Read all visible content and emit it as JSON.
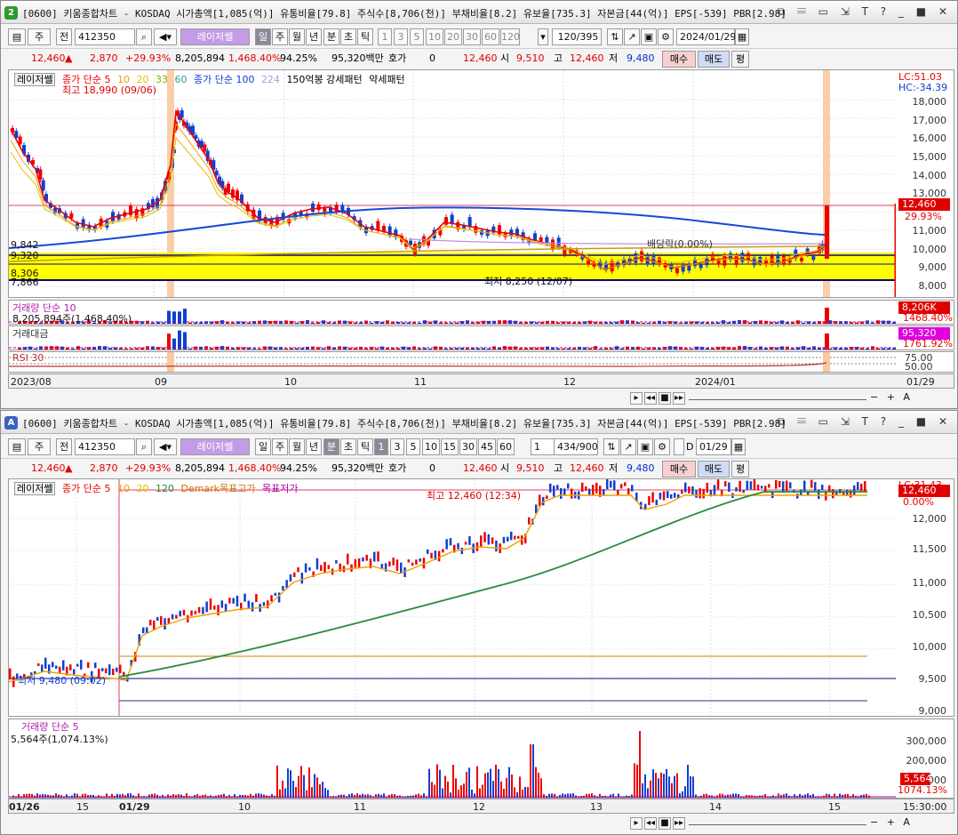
{
  "window1": {
    "badge": "2",
    "title": "[0600] 키움종합차트 - KOSDAQ 시가총액[1,085(억)] 유통비율[79.8] 주식수[8,706(천)] 부채비율[8.2] 유보율[735.3] 자본금[44(억)] EPS[-539] PBR[2.98]",
    "title_controls": "⧉ 𝄘 ▭ ⇲ T ? _ ■ ✕",
    "toolbar": {
      "code_prefix": "주",
      "all_label": "전",
      "stock_code": "412350",
      "search_icon": "🔍",
      "sound_icon": "◀)",
      "stock_name": "레이저쎌",
      "periods": [
        "일",
        "주",
        "월",
        "년",
        "분",
        "초",
        "틱"
      ],
      "minutes": [
        "1",
        "3",
        "5",
        "10",
        "20",
        "30",
        "60",
        "120"
      ],
      "count": "120/395",
      "date": "2024/01/29"
    },
    "quote": {
      "price": "12,460",
      "arrow": "▲",
      "change": "2,870",
      "pct": "+29.93%",
      "volume": "8,205,894",
      "vol_ratio": "1,468.40%",
      "ratio2": "94.25%",
      "amount": "95,320백만",
      "hoga_label": "호가",
      "hoga": "0",
      "hoga_price": "12,460",
      "open_label": "시",
      "open": "9,510",
      "high_label": "고",
      "high": "12,460",
      "low_label": "저",
      "low": "9,480",
      "buy": "매수",
      "sell": "매도",
      "flat": "평"
    },
    "legend": {
      "name": "레이저쎌",
      "ma_label": "종가 단순 5",
      "ma10": "10",
      "ma20": "20",
      "ma33": "33",
      "ma60": "60",
      "ma100": "종가 단순 100",
      "ma224": "224",
      "pattern": "150억봉 강세패턴",
      "weak": "약세패턴"
    },
    "annotations": {
      "high": "최고 18,990 (09/06)",
      "low": "최저 8,250 (12/07)",
      "dividend": "배당락(0.00%)",
      "lc": "LC:51.03",
      "hc": "HC:-34.39",
      "lvl1": "9,842",
      "lvl2": "9,320",
      "lvl3": "8,306",
      "lvl4": "7,866"
    },
    "y_labels": [
      "18,000",
      "17,000",
      "16,000",
      "15,000",
      "14,000",
      "13,000",
      "11,000",
      "10,000",
      "9,000",
      "8,000"
    ],
    "price_box": "12,460",
    "price_pct": "29.93%",
    "volume": {
      "label": "거래량 단순 10",
      "value": "8,205,894주(1,468.40%)",
      "box": "8,206K",
      "pct": "1468.40%"
    },
    "amount": {
      "label": "거래대금",
      "box": "95,320",
      "pct": "1761.92%"
    },
    "rsi": {
      "label": "RSI 30",
      "lvl75": "75.00",
      "lvl50": "50.00"
    },
    "x_labels": [
      "2023/08",
      "09",
      "10",
      "11",
      "12",
      "2024/01",
      "01/29"
    ]
  },
  "window2": {
    "badge": "A",
    "title": "[0600] 키움종합차트 - KOSDAQ 시가총액[1,085(억)] 유통비율[79.8] 주식수[8,706(천)] 부채비율[8.2] 유보율[735.3] 자본금[44(억)] EPS[-539] PBR[2.98]",
    "title_controls": "⧉ 𝄘 ▭ ⇲ T ? _ ■ ✕",
    "toolbar": {
      "code_prefix": "주",
      "all_label": "전",
      "stock_code": "412350",
      "stock_name": "레이저쎌",
      "periods": [
        "일",
        "주",
        "월",
        "년",
        "분",
        "초",
        "틱"
      ],
      "minutes": [
        "1",
        "3",
        "5",
        "10",
        "15",
        "30",
        "45",
        "60"
      ],
      "unit": "1",
      "count": "434/900",
      "d_label": "D",
      "date": "01/29"
    },
    "quote": {
      "price": "12,460",
      "arrow": "▲",
      "change": "2,870",
      "pct": "+29.93%",
      "volume": "8,205,894",
      "vol_ratio": "1,468.40%",
      "ratio2": "94.25%",
      "amount": "95,320백만",
      "hoga_label": "호가",
      "hoga": "0",
      "hoga_price": "12,460",
      "open_label": "시",
      "open": "9,510",
      "high_label": "고",
      "high": "12,460",
      "low_label": "저",
      "low": "9,480",
      "buy": "매수",
      "sell": "매도",
      "flat": "평"
    },
    "legend": {
      "name": "레이저쎌",
      "ma_label": "종가 단순 5",
      "ma10": "10",
      "ma20": "20",
      "ma120": "120",
      "demark": "Demark목표고가",
      "target_low": "목표저가"
    },
    "annotations": {
      "high": "최고 12,460 (12:34)",
      "low": "최저 9,480 (09:02)",
      "lc": "LC:31.43"
    },
    "y_labels": [
      "12,000",
      "11,500",
      "11,000",
      "10,500",
      "10,000",
      "9,500",
      "9,000"
    ],
    "price_box": "12,460",
    "price_pct": "0.00%",
    "volume": {
      "label": "거래량 단순 5",
      "value": "5,564주(1,074.13%)",
      "y": [
        "300,000",
        "200,000",
        "100,000"
      ],
      "box": "5,564",
      "pct": "1074.13%"
    },
    "x_labels": [
      "01/26",
      "15",
      "01/29",
      "10",
      "11",
      "12",
      "13",
      "14",
      "15",
      "15:30:00"
    ]
  }
}
